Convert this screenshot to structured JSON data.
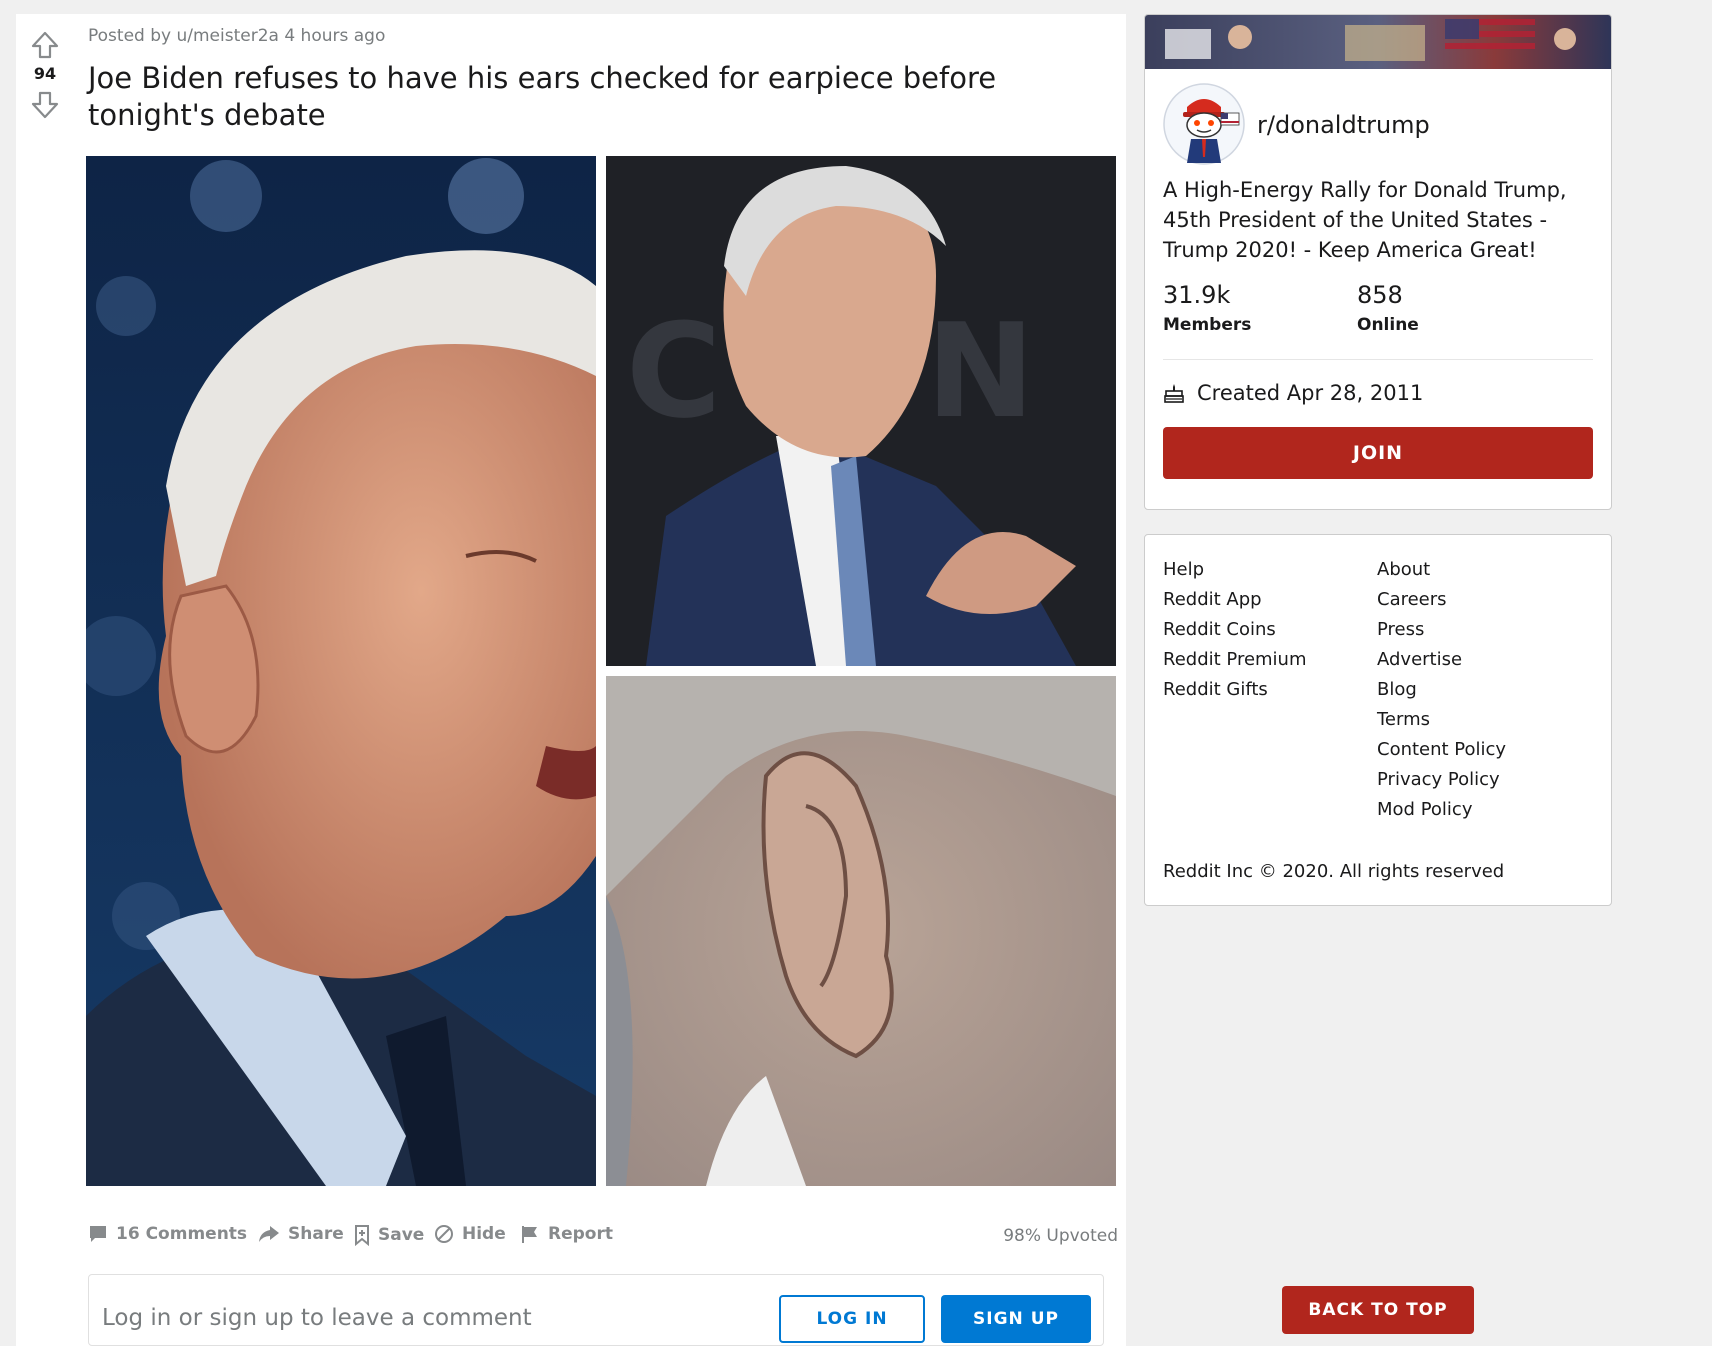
{
  "post": {
    "meta": "Posted by u/meister2a 4 hours ago",
    "score": "94",
    "title": "Joe Biden refuses to have his ears checked for earpiece before tonight's debate",
    "actions": {
      "comments": "16 Comments",
      "share": "Share",
      "save": "Save",
      "hide": "Hide",
      "report": "Report"
    },
    "upvoted": "98% Upvoted"
  },
  "comment_box": {
    "prompt": "Log in or sign up to leave a comment",
    "login_label": "LOG IN",
    "signup_label": "SIGN UP"
  },
  "subreddit": {
    "name": "r/donaldtrump",
    "description": "A High-Energy Rally for Donald Trump, 45th President of the United States - Trump 2020! - Keep America Great!",
    "members_value": "31.9k",
    "members_label": "Members",
    "online_value": "858",
    "online_label": "Online",
    "created": "Created Apr 28, 2011",
    "join_label": "JOIN"
  },
  "footer": {
    "left_links": [
      "Help",
      "Reddit App",
      "Reddit Coins",
      "Reddit Premium",
      "Reddit Gifts"
    ],
    "right_links": [
      "About",
      "Careers",
      "Press",
      "Advertise",
      "Blog",
      "Terms",
      "Content Policy",
      "Privacy Policy",
      "Mod Policy"
    ],
    "copyright": "Reddit Inc © 2020. All rights reserved"
  },
  "back_to_top_label": "BACK TO TOP",
  "colors": {
    "brand_red": "#b1261d",
    "link_blue": "#0079d3",
    "muted_gray": "#878a8c"
  }
}
